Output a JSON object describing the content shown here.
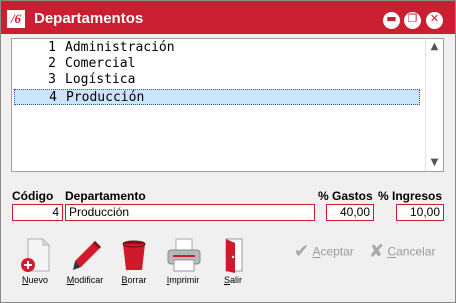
{
  "window": {
    "title": "Departamentos",
    "logo_text": "/6"
  },
  "titlebar_buttons": [
    {
      "name": "minimize-button",
      "glyph": "▬"
    },
    {
      "name": "maximize-button",
      "glyph": "❐"
    },
    {
      "name": "close-button",
      "glyph": "✕"
    }
  ],
  "list": {
    "rows": [
      {
        "code": "1",
        "name": "Administración",
        "selected": false
      },
      {
        "code": "2",
        "name": "Comercial",
        "selected": false
      },
      {
        "code": "3",
        "name": "Logística",
        "selected": false
      },
      {
        "code": "4",
        "name": "Producción",
        "selected": true
      }
    ]
  },
  "form": {
    "codigo_label": "Código",
    "departamento_label": "Departamento",
    "gastos_label": "% Gastos",
    "ingresos_label": "% Ingresos",
    "codigo_value": "4",
    "departamento_value": "Producción",
    "gastos_value": "40,00",
    "ingresos_value": "10,00"
  },
  "toolbar": {
    "nuevo": {
      "first": "N",
      "rest": "uevo"
    },
    "modificar": {
      "first": "M",
      "rest": "odificar"
    },
    "borrar": {
      "first": "B",
      "rest": "orrar"
    },
    "imprimir": {
      "first": "I",
      "rest": "mprimir"
    },
    "salir": {
      "first": "S",
      "rest": "alir"
    }
  },
  "actions": {
    "aceptar": {
      "first": "A",
      "rest": "ceptar",
      "enabled": false
    },
    "cancelar": {
      "first": "C",
      "rest": "ancelar",
      "enabled": false
    }
  },
  "colors": {
    "titlebar": "#ca1f30",
    "field_border": "#cc1f2e",
    "selection": "#cce4f7",
    "disabled_text": "#9a9a9a"
  }
}
